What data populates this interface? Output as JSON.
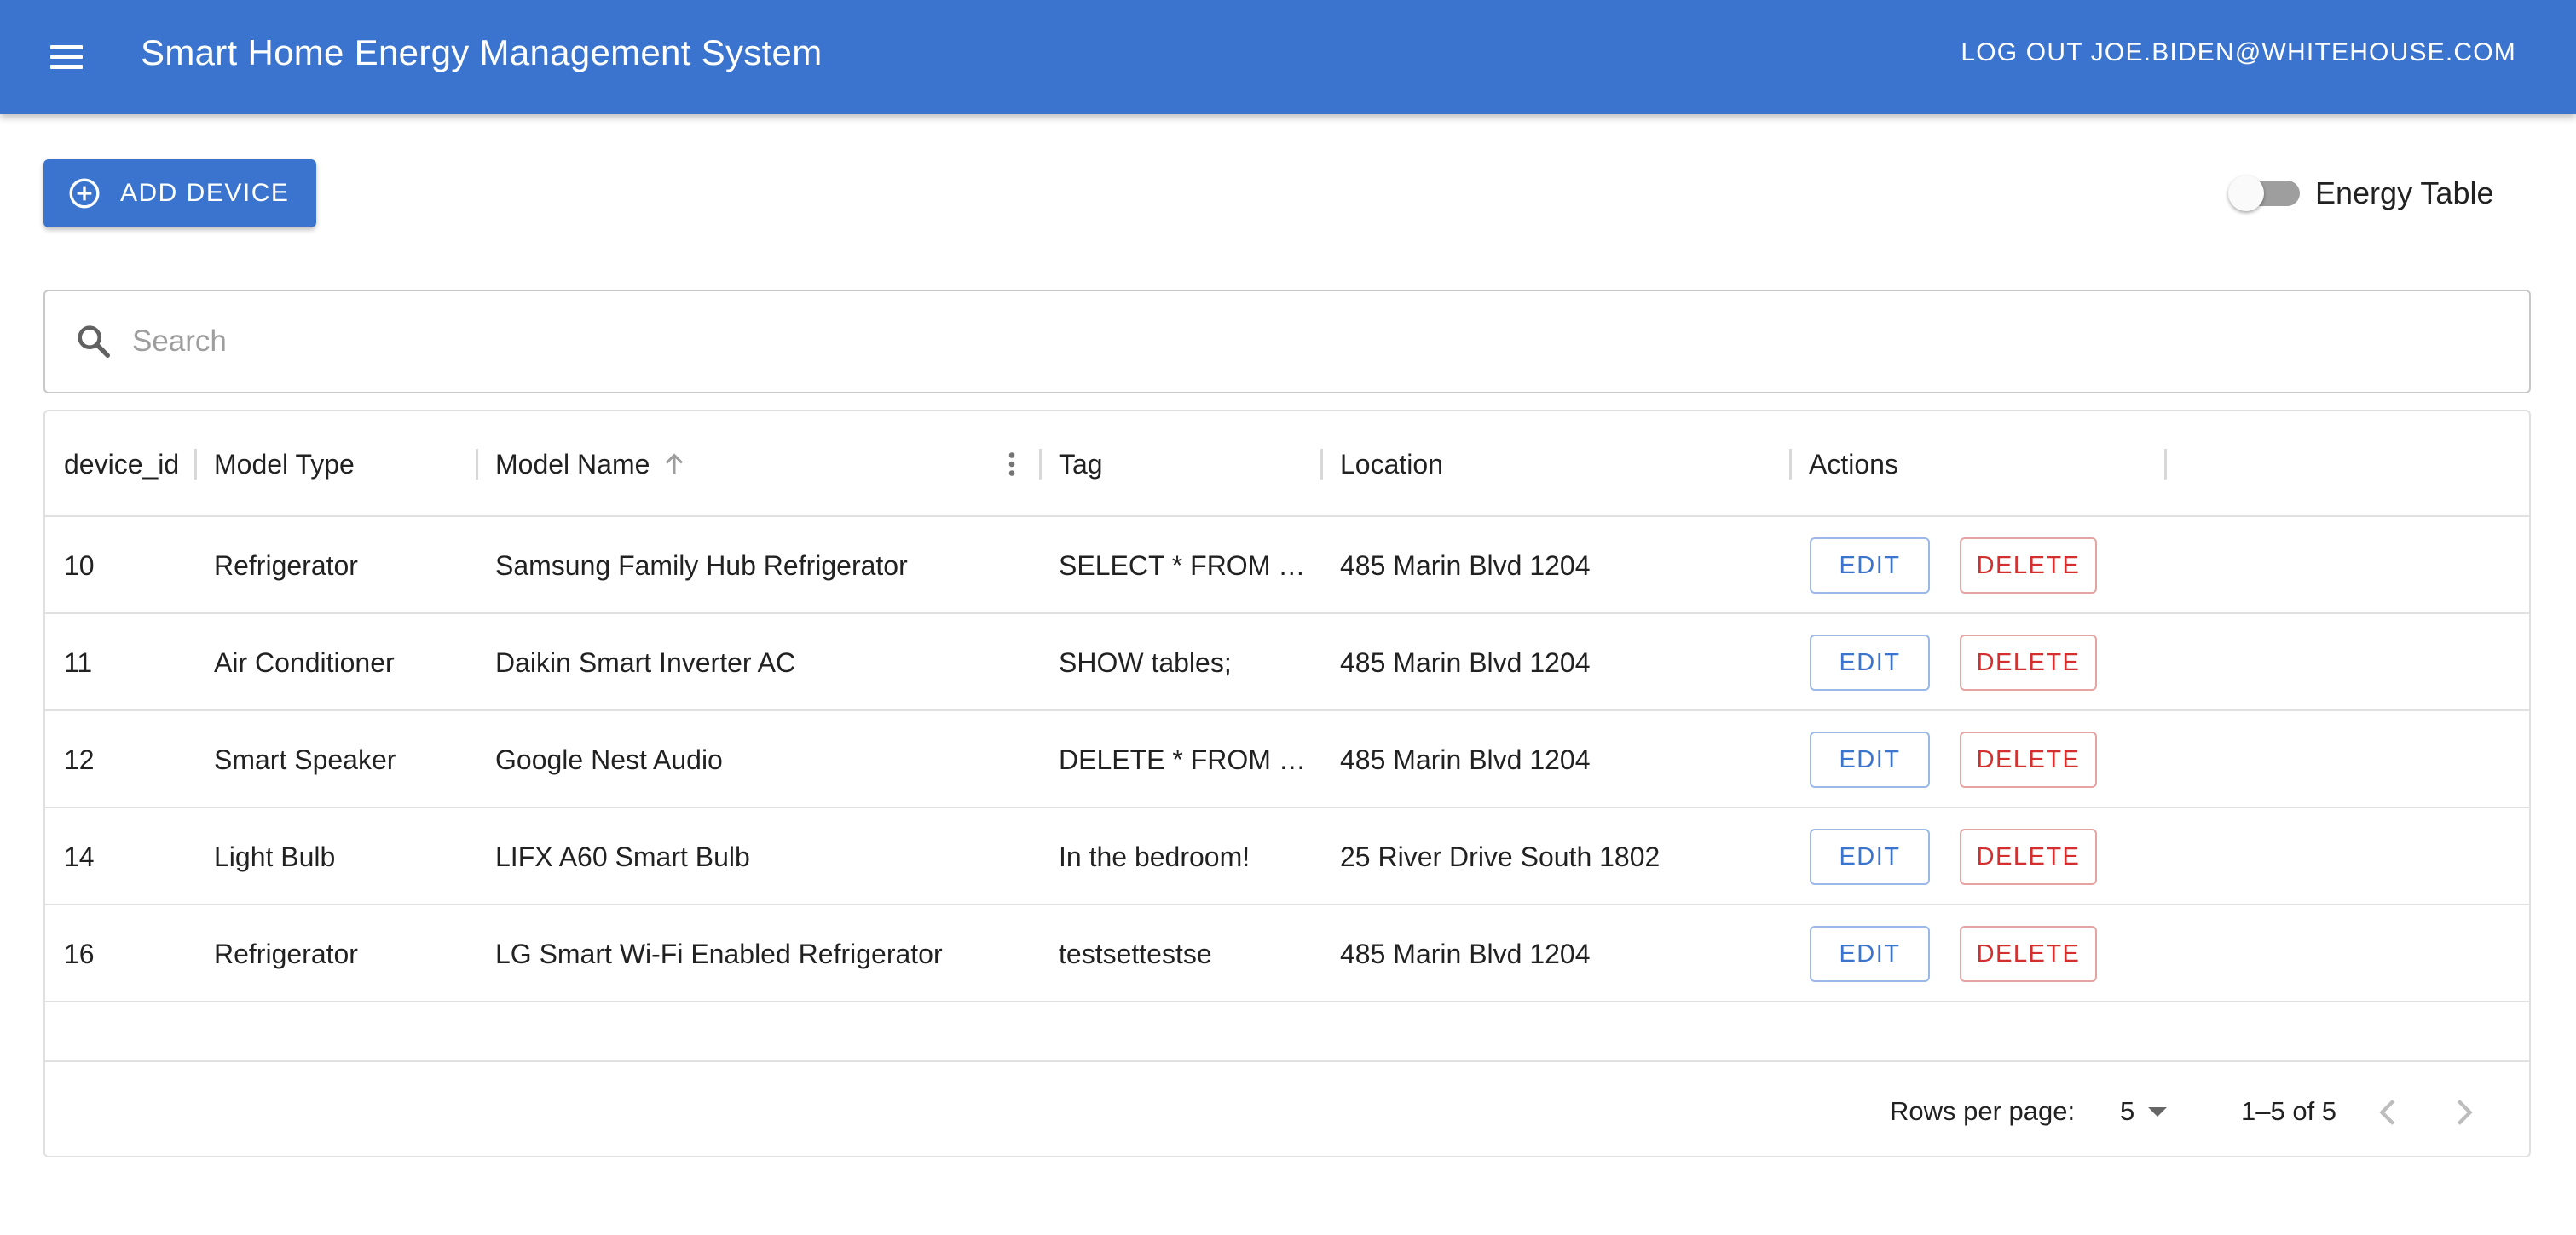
{
  "app": {
    "title": "Smart Home Energy Management System",
    "logout_label": "LOG OUT JOE.BIDEN@WHITEHOUSE.COM",
    "accent_color": "#3a74ce"
  },
  "toolbar": {
    "add_device_label": "ADD DEVICE",
    "toggle_label": "Energy Table",
    "toggle_on": false
  },
  "search": {
    "placeholder": "Search",
    "value": ""
  },
  "table": {
    "columns": [
      "device_id",
      "Model Type",
      "Model Name",
      "Tag",
      "Location",
      "Actions"
    ],
    "sorted_column": "Model Name",
    "sort_direction": "ascending",
    "rows": [
      {
        "device_id": "10",
        "model_type": "Refrigerator",
        "model_name": "Samsung Family Hub Refrigerator",
        "tag": "SELECT * FROM …",
        "location": "485 Marin Blvd 1204"
      },
      {
        "device_id": "11",
        "model_type": "Air Conditioner",
        "model_name": "Daikin Smart Inverter AC",
        "tag": "SHOW tables;",
        "location": "485 Marin Blvd 1204"
      },
      {
        "device_id": "12",
        "model_type": "Smart Speaker",
        "model_name": "Google Nest Audio",
        "tag": "DELETE * FROM …",
        "location": "485 Marin Blvd 1204"
      },
      {
        "device_id": "14",
        "model_type": "Light Bulb",
        "model_name": "LIFX A60 Smart Bulb",
        "tag": "In the bedroom!",
        "location": "25 River Drive South 1802"
      },
      {
        "device_id": "16",
        "model_type": "Refrigerator",
        "model_name": "LG Smart Wi-Fi Enabled Refrigerator",
        "tag": "testsettestse",
        "location": "485 Marin Blvd 1204"
      }
    ],
    "edit_label": "EDIT",
    "delete_label": "DELETE"
  },
  "pagination": {
    "rows_per_page_label": "Rows per page:",
    "rows_per_page": "5",
    "range_label": "1–5 of 5"
  },
  "icons": {
    "menu": "menu-icon",
    "add": "add-circle-icon",
    "search": "search-icon",
    "sort": "arrow-up-icon",
    "column_menu": "more-vert-icon",
    "prev": "chevron-left-icon",
    "next": "chevron-right-icon"
  }
}
